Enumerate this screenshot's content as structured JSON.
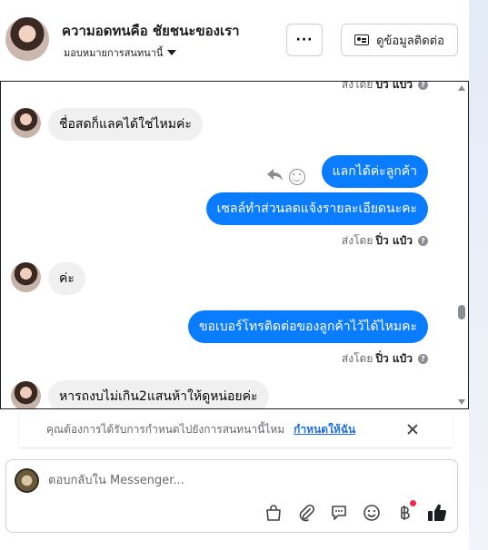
{
  "header": {
    "conversation_name": "ความอดทนคือ ชัยชนะของเรา",
    "assign_label": "มอบหมายการสนทนานี้",
    "more_label": "···",
    "contact_label": "ดูข้อมูลติดต่อ"
  },
  "thread": {
    "sent_by_prefix": "ส่งโดย",
    "sent_by_name": "ปิ่ว แป๋ว",
    "messages": [
      {
        "side": "in",
        "text": "ชื่อสดก็แลคได้ใช่ไหมค่ะ"
      },
      {
        "side": "out",
        "text": "แลกได้ค่ะลูกค้า"
      },
      {
        "side": "out",
        "text": "เซลล์ทำส่วนลดแจ้งรายละเอียดนะคะ"
      },
      {
        "side": "in",
        "text": "ค่ะ"
      },
      {
        "side": "out",
        "text": "ขอเบอร์โทรติดต่อของลูกค้าไว้ได้ไหมคะ"
      },
      {
        "side": "in",
        "text": "หารถงบไม่เกิน2แสนห้าให้ดูหน่อยค่ะ"
      }
    ]
  },
  "prompt": {
    "text": "คุณต้องการได้รับการกำหนดไปยังการสนทนานี้ไหม",
    "link": "กำหนดให้ฉัน"
  },
  "composer": {
    "placeholder": "ตอบกลับใน Messenger..."
  },
  "colors": {
    "outgoing_bubble": "#0a7cff",
    "incoming_bubble": "#f0f0f0",
    "link": "#216fdb",
    "badge": "#f02849"
  }
}
